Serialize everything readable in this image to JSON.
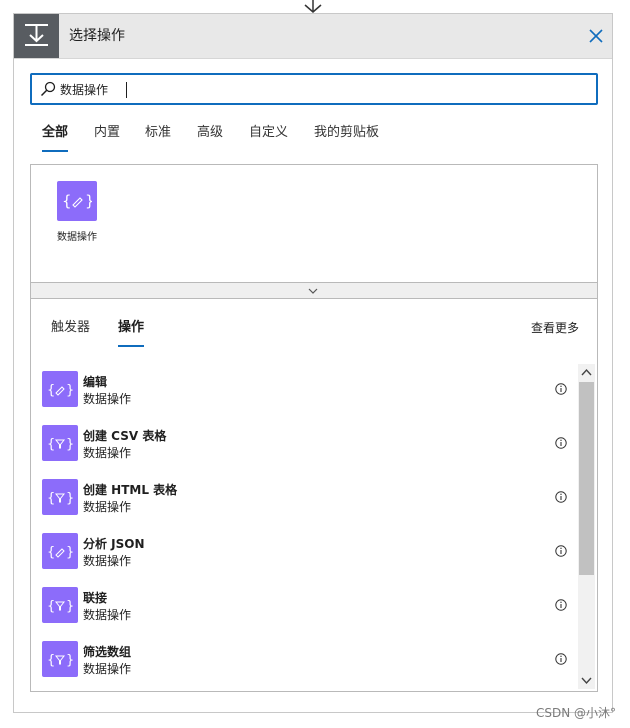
{
  "header": {
    "title": "选择操作",
    "close_icon": "close-icon",
    "trigger_icon": "flow-step-icon"
  },
  "search": {
    "value": "数据操作",
    "placeholder": ""
  },
  "tabs": [
    {
      "label": "全部",
      "active": true
    },
    {
      "label": "内置",
      "active": false
    },
    {
      "label": "标准",
      "active": false
    },
    {
      "label": "高级",
      "active": false
    },
    {
      "label": "自定义",
      "active": false
    },
    {
      "label": "我的剪贴板",
      "active": false
    }
  ],
  "connectors": [
    {
      "label": "数据操作",
      "icon": "data-operation-icon"
    }
  ],
  "panel": {
    "subtabs": [
      {
        "label": "触发器",
        "active": false
      },
      {
        "label": "操作",
        "active": true
      }
    ],
    "see_more": "查看更多"
  },
  "actions": [
    {
      "name": "编辑",
      "connector": "数据操作",
      "icon": "edit-braces-icon"
    },
    {
      "name": "创建 CSV 表格",
      "connector": "数据操作",
      "icon": "filter-braces-icon"
    },
    {
      "name": "创建 HTML 表格",
      "connector": "数据操作",
      "icon": "filter-braces-icon"
    },
    {
      "name": "分析 JSON",
      "connector": "数据操作",
      "icon": "edit-braces-icon"
    },
    {
      "name": "联接",
      "connector": "数据操作",
      "icon": "filter-braces-icon"
    },
    {
      "name": "筛选数组",
      "connector": "数据操作",
      "icon": "filter-braces-icon"
    }
  ],
  "watermark": "CSDN @小沐°",
  "colors": {
    "accent": "#0f6cbd",
    "connector": "#8c6cfa",
    "header_icon_bg": "#585c61"
  }
}
